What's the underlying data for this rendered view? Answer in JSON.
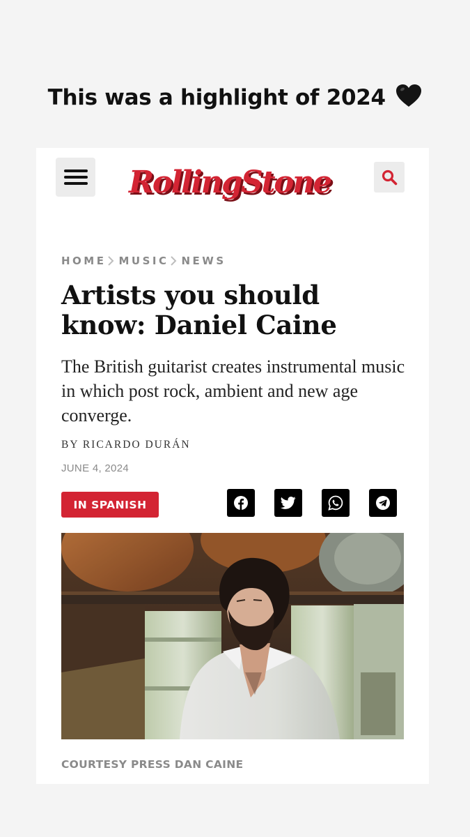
{
  "story": {
    "caption": "This was a highlight of 2024",
    "emoji": "black-heart-icon"
  },
  "header": {
    "logo_text": "RollingStone",
    "brand_color": "#d32433",
    "menu_icon": "hamburger-menu-icon",
    "search_icon": "search-icon"
  },
  "breadcrumb": {
    "items": [
      "HOME",
      "MUSIC",
      "NEWS"
    ],
    "separator_icon": "chevron-right-icon"
  },
  "article": {
    "headline": "Artists you should know: Daniel Caine",
    "subhead": "The British guitarist creates instrumental music in which post rock, ambient and new age converge.",
    "byline": "BY RICARDO DURÁN",
    "date": "JUNE 4, 2024",
    "language_badge": "IN SPANISH",
    "photo_credit": "COURTESY PRESS DAN CAINE"
  },
  "share": {
    "buttons": [
      "facebook-icon",
      "twitter-icon",
      "whatsapp-icon",
      "telegram-icon"
    ]
  },
  "hero_image": {
    "subject": "photo-portrait"
  }
}
